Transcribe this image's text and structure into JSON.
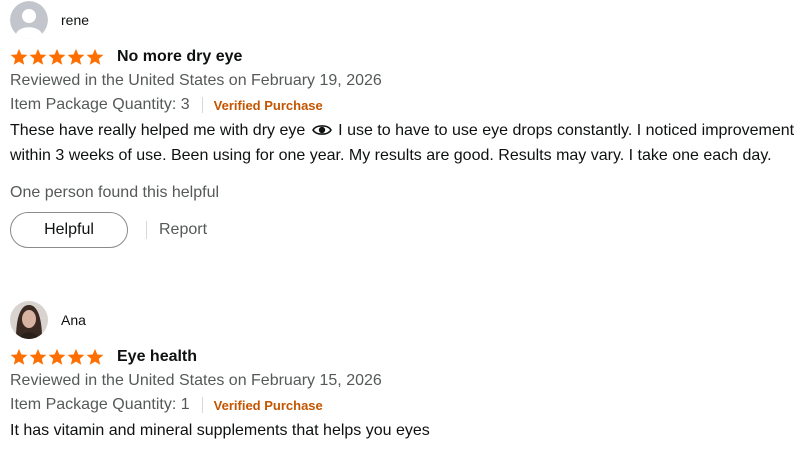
{
  "reviews": [
    {
      "name": "rene",
      "avatar_icon": "default-profile-icon",
      "rating": 5,
      "title": "No more dry eye",
      "meta": "Reviewed in the United States on February 19, 2026",
      "variant": "Item Package Quantity: 3",
      "verified": "Verified Purchase",
      "body_before_icon": "These have really helped me with dry eye",
      "body_icon": "eye-icon",
      "body_after_icon": "I use to have to use eye drops constantly. I noticed improvement within 3 weeks of use. Been using for one year. My results are good. Results may vary. I take one each day.",
      "helpful_count_text": "One person found this helpful",
      "helpful_button": "Helpful",
      "report_link": "Report"
    },
    {
      "name": "Ana",
      "avatar_icon": "user-photo",
      "rating": 5,
      "title": "Eye health",
      "meta": "Reviewed in the United States on February 15, 2026",
      "variant": "Item Package Quantity: 1",
      "verified": "Verified Purchase",
      "body": "It has vitamin and mineral supplements that helps you eyes"
    }
  ],
  "colors": {
    "star": "#ff6f00",
    "verified": "#c45500",
    "secondary_text": "#565959"
  }
}
